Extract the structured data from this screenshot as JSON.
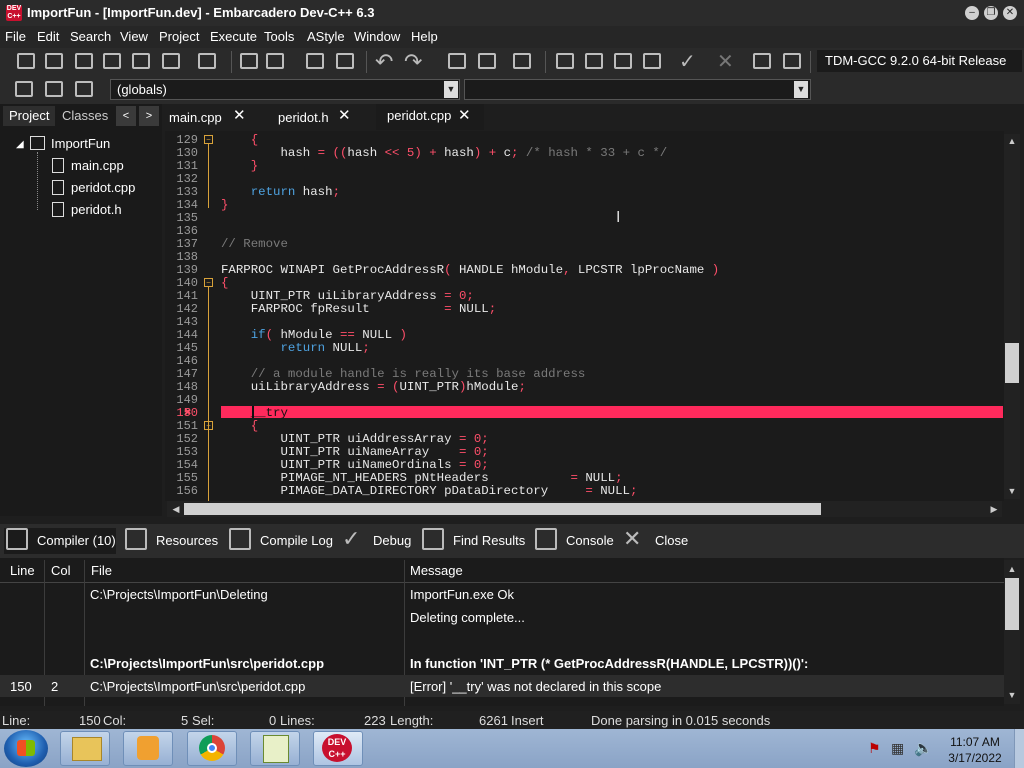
{
  "window": {
    "title": "ImportFun - [ImportFun.dev] - Embarcadero Dev-C++ 6.3",
    "logo_text": "DEV C++"
  },
  "menu": [
    "File",
    "Edit",
    "Search",
    "View",
    "Project",
    "Execute",
    "Tools",
    "AStyle",
    "Window",
    "Help"
  ],
  "toolbar": {
    "compiler": "TDM-GCC 9.2.0 64-bit Release",
    "scope": "(globals)"
  },
  "left_panel": {
    "tabs": [
      "Project",
      "Classes"
    ],
    "nav_prev": "<",
    "nav_next": ">",
    "project_name": "ImportFun",
    "files": [
      "main.cpp",
      "peridot.cpp",
      "peridot.h"
    ]
  },
  "editor_tabs": [
    {
      "label": "main.cpp",
      "close": "✕"
    },
    {
      "label": "peridot.h",
      "close": "✕"
    },
    {
      "label": "peridot.cpp",
      "close": "✕"
    }
  ],
  "editor": {
    "line_numbers": [
      "129",
      "130",
      "131",
      "132",
      "133",
      "134",
      "135",
      "136",
      "137",
      "138",
      "139",
      "140",
      "141",
      "142",
      "143",
      "144",
      "145",
      "146",
      "147",
      "148",
      "149",
      "150",
      "151",
      "152",
      "153",
      "154",
      "155",
      "156"
    ],
    "error_line": "150"
  },
  "bottom_tabs": [
    "Compiler (10)",
    "Resources",
    "Compile Log",
    "Debug",
    "Find Results",
    "Console",
    "Close"
  ],
  "messages": {
    "headers": {
      "line": "Line",
      "col": "Col",
      "file": "File",
      "message": "Message"
    },
    "rows": [
      {
        "line": "",
        "col": "",
        "file": "C:\\Projects\\ImportFun\\Deleting",
        "message": "ImportFun.exe Ok",
        "bold": false
      },
      {
        "line": "",
        "col": "",
        "file": "",
        "message": "Deleting complete...",
        "bold": false
      },
      {
        "line": "",
        "col": "",
        "file": "",
        "message": "",
        "bold": false
      },
      {
        "line": "",
        "col": "",
        "file": "C:\\Projects\\ImportFun\\src\\peridot.cpp",
        "message": "In function 'INT_PTR (* GetProcAddressR(HANDLE, LPCSTR))()':",
        "bold": true
      },
      {
        "line": "150",
        "col": "2",
        "file": "C:\\Projects\\ImportFun\\src\\peridot.cpp",
        "message": "[Error] '__try' was not declared in this scope",
        "bold": false
      }
    ]
  },
  "status": {
    "line_label": "Line:",
    "line_value": "150",
    "col_label": "Col:",
    "col_value": "5",
    "sel_label": "Sel:",
    "sel_value": "0",
    "lines_label": "Lines:",
    "lines_value": "223",
    "length_label": "Length:",
    "length_value": "6261",
    "mode": "Insert",
    "message": "Done parsing in 0.015 seconds"
  },
  "taskbar": {
    "time": "11:07 AM",
    "date": "3/17/2022",
    "devcpp_text": "DEV C++"
  }
}
